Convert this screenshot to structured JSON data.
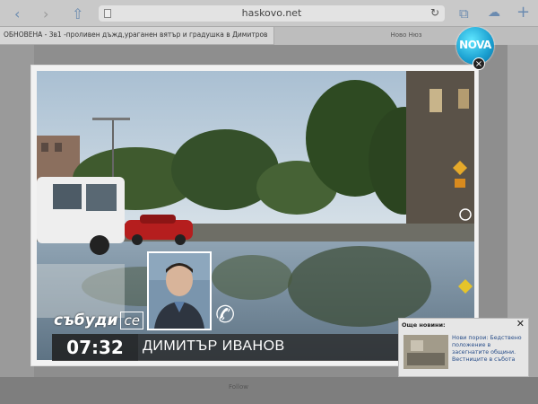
{
  "browser": {
    "back_label": "‹",
    "forward_label": "›",
    "share_label": "⇧",
    "url": "haskovo.net",
    "reload_label": "↻",
    "bookmarks_label": "⧉",
    "cloud_label": "☁",
    "add_label": "+",
    "tab_active_title": "ОБНОВЕНА - 3в1 -проливен дъжд,ураганен вятър и градушка в Димитровг...",
    "tab_other_title": "Ново Нюз"
  },
  "channel": {
    "logo_text": "NOVA",
    "close_label": "×"
  },
  "lower_third": {
    "brand_main": "събуди",
    "brand_suffix": "се",
    "time": "07:32",
    "caller_name": "ДИМИТЪР ИВАНОВ",
    "phone_icon": "phone-icon"
  },
  "news_popup": {
    "header": "Още новини:",
    "close_label": "✕",
    "headline": "Нови порои: Бедствено положение в засегнатите общини. Вестниците в събота"
  },
  "background_page": {
    "bottom_label": "Follow"
  }
}
